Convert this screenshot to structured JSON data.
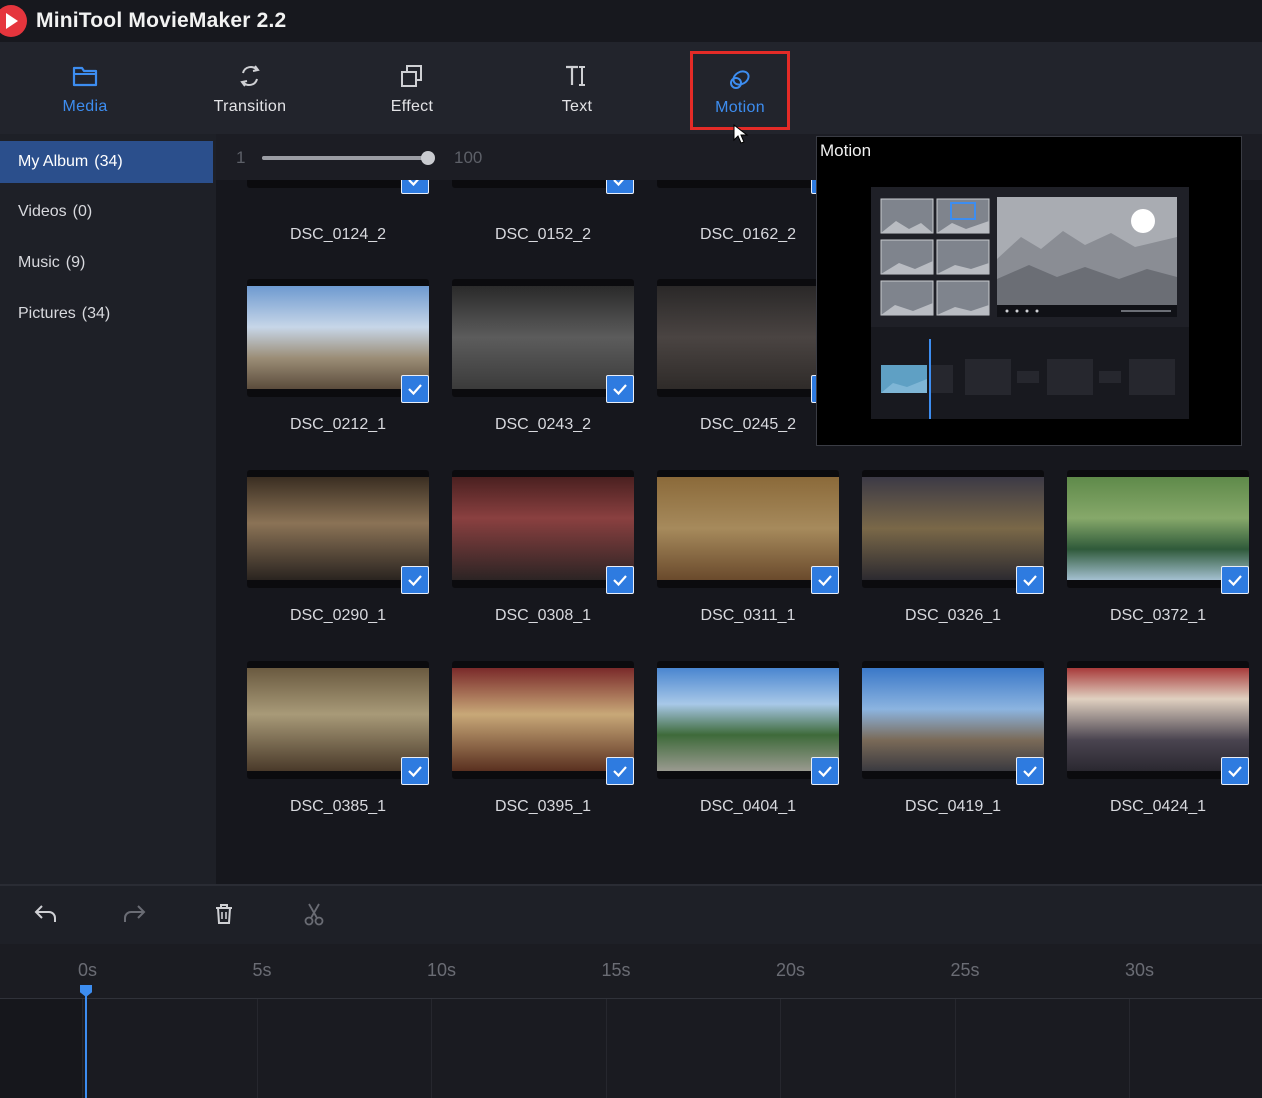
{
  "app": {
    "title": "MiniTool MovieMaker 2.2",
    "accent": "#3d8df0",
    "highlight": "#e42b27"
  },
  "toolbar": {
    "media": "Media",
    "transition": "Transition",
    "effect": "Effect",
    "text": "Text",
    "motion": "Motion"
  },
  "sidebar": {
    "items": [
      {
        "label": "My Album",
        "count": "(34)",
        "active": true
      },
      {
        "label": "Videos",
        "count": "(0)"
      },
      {
        "label": "Music",
        "count": "(9)"
      },
      {
        "label": "Pictures",
        "count": "(34)"
      }
    ]
  },
  "zoom": {
    "min": "1",
    "max": "100",
    "value_fraction": 1.0
  },
  "media_items": [
    {
      "name": "DSC_0124_2",
      "checked": true
    },
    {
      "name": "DSC_0152_2",
      "checked": true
    },
    {
      "name": "DSC_0162_2",
      "checked": true
    },
    {
      "name": "DSC_0212_1",
      "checked": true
    },
    {
      "name": "DSC_0243_2",
      "checked": true
    },
    {
      "name": "DSC_0245_2",
      "checked": true
    },
    {
      "name": "DSC_0290_1",
      "checked": true
    },
    {
      "name": "DSC_0308_1",
      "checked": true
    },
    {
      "name": "DSC_0311_1",
      "checked": true
    },
    {
      "name": "DSC_0326_1",
      "checked": true
    },
    {
      "name": "DSC_0372_1",
      "checked": true
    },
    {
      "name": "DSC_0385_1",
      "checked": true
    },
    {
      "name": "DSC_0395_1",
      "checked": true
    },
    {
      "name": "DSC_0404_1",
      "checked": true
    },
    {
      "name": "DSC_0419_1",
      "checked": true
    },
    {
      "name": "DSC_0424_1",
      "checked": true
    }
  ],
  "motion_popup": {
    "title": "Motion"
  },
  "timeline": {
    "ticks": [
      "0s",
      "5s",
      "10s",
      "15s",
      "20s",
      "25s",
      "30s"
    ]
  }
}
